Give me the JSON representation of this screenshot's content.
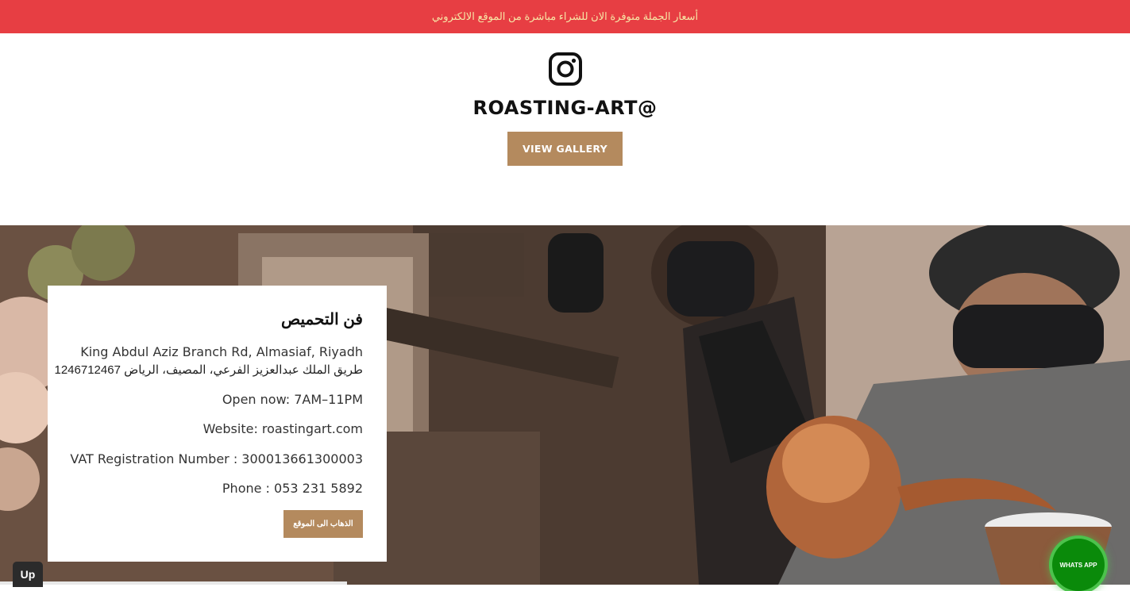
{
  "announcement": {
    "text": "أسعار الجملة متوفرة الان للشراء مباشرة من الموقع الالكتروني"
  },
  "instagram": {
    "icon": "instagram-icon",
    "handle": "ROASTING-ART@",
    "gallery_button": "VIEW GALLERY"
  },
  "hero": {
    "image": "baristas-pouring-coffee-photo"
  },
  "info_card": {
    "title": "فن التحميص",
    "address_en": "King Abdul Aziz Branch Rd, Almasiaf, Riyadh",
    "address_ar": "12467طريق الملك عبدالعزيز الفرعي، المصيف، الرياض 12467",
    "hours": "Open now:  7AM–11PM",
    "website": "Website: roastingart.com",
    "vat": "VAT Registration Number : 300013661300003",
    "phone": "Phone : 053 231 5892",
    "location_button": "الذهاب الى الموقع"
  },
  "floating": {
    "up_label": "Up",
    "whatsapp_label": "WHATS APP"
  },
  "colors": {
    "announce_bg": "#e73e43",
    "announce_text": "#f7e7a6",
    "accent_button": "#b48a5e",
    "whatsapp": "#0a8a0a"
  }
}
